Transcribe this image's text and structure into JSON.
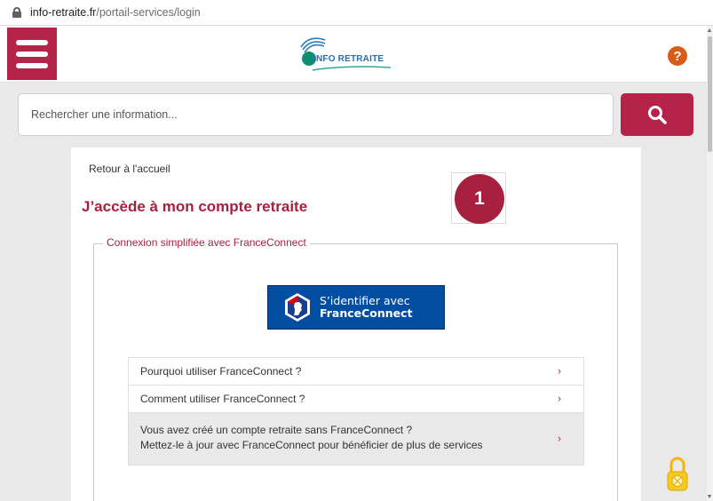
{
  "browser": {
    "url_domain": "info-retraite.fr",
    "url_path": "/portail-services/login"
  },
  "header": {
    "logo_text": "INFO RETRAITE",
    "help_label": "?"
  },
  "search": {
    "placeholder": "Rechercher une information..."
  },
  "content": {
    "back_link": "Retour à l'accueil",
    "title": "J’accède à mon compte retraite",
    "step_number": "1",
    "fieldset_legend": "Connexion simplifiée avec FranceConnect",
    "fc_button": {
      "line1": "S’identifier avec",
      "line2": "FranceConnect"
    },
    "faq": [
      {
        "text": "Pourquoi utiliser FranceConnect ?"
      },
      {
        "text": "Comment utiliser FranceConnect ?"
      },
      {
        "line1": "Vous avez créé un compte retraite sans FranceConnect ?",
        "line2": "Mettez-le à jour avec FranceConnect pour bénéficier de plus de services"
      }
    ],
    "chevron": "›"
  },
  "colors": {
    "brand": "#b52348",
    "title": "#a8203f",
    "fc_blue": "#034ea2",
    "help": "#d95d1a"
  },
  "icons": [
    "lock-icon",
    "hamburger-menu-icon",
    "help-icon",
    "search-icon",
    "franceconnect-logo-icon",
    "chevron-right-icon",
    "padlock-widget-icon"
  ]
}
